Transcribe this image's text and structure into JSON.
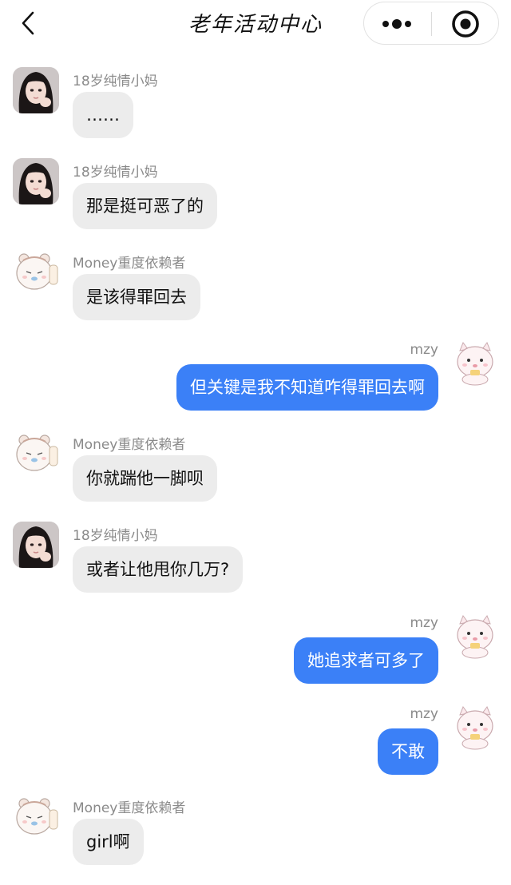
{
  "header": {
    "title": "老年活动中心",
    "back_icon": "chevron-left-icon",
    "more_icon": "more-dots-icon",
    "close_icon": "target-close-icon"
  },
  "colors": {
    "self_bubble": "#3b80f7",
    "other_bubble": "#ececec",
    "sender_name": "#8a8a8a"
  },
  "messages": [
    {
      "sender": "18岁纯情小妈",
      "text": "……",
      "side": "left",
      "avatar": "girl-photo-avatar"
    },
    {
      "sender": "18岁纯情小妈",
      "text": "那是挺可恶了的",
      "side": "left",
      "avatar": "girl-photo-avatar"
    },
    {
      "sender": "Money重度依赖者",
      "text": "是该得罪回去",
      "side": "left",
      "avatar": "cartoon-bear-avatar"
    },
    {
      "sender": "mzy",
      "text": "但关键是我不知道咋得罪回去啊",
      "side": "right",
      "avatar": "cartoon-cat-avatar"
    },
    {
      "sender": "Money重度依赖者",
      "text": "你就踹他一脚呗",
      "side": "left",
      "avatar": "cartoon-bear-avatar"
    },
    {
      "sender": "18岁纯情小妈",
      "text": "或者让他甩你几万?",
      "side": "left",
      "avatar": "girl-photo-avatar"
    },
    {
      "sender": "mzy",
      "text": "她追求者可多了",
      "side": "right",
      "avatar": "cartoon-cat-avatar"
    },
    {
      "sender": "mzy",
      "text": "不敢",
      "side": "right",
      "avatar": "cartoon-cat-avatar"
    },
    {
      "sender": "Money重度依赖者",
      "text": "girl啊",
      "side": "left",
      "avatar": "cartoon-bear-avatar"
    }
  ]
}
